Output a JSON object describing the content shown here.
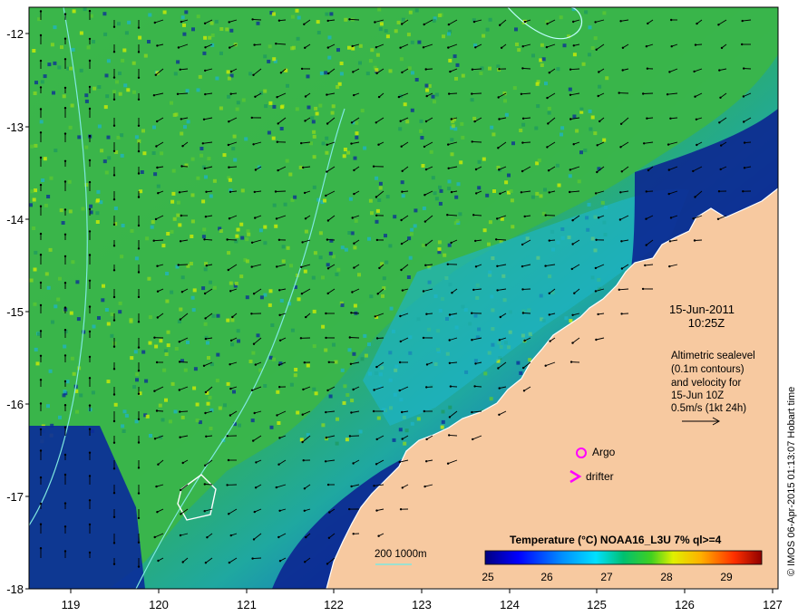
{
  "map": {
    "lat_ticks": [
      "-12",
      "-13",
      "-14",
      "-15",
      "-16",
      "-17",
      "-18"
    ],
    "lon_ticks": [
      "119",
      "120",
      "121",
      "122",
      "123",
      "124",
      "125",
      "126",
      "127"
    ],
    "lat_range": [
      -18,
      -11.8
    ],
    "lon_range": [
      118.55,
      127
    ]
  },
  "annotations": {
    "date": "15-Jun-2011",
    "time": "10:25Z",
    "altimetry_lines": [
      "Altimetric sealevel",
      "(0.1m contours)",
      "and velocity for",
      "15-Jun 10Z",
      "0.5m/s (1kt 24h)"
    ],
    "argo_label": "Argo",
    "drifter_label": "drifter",
    "bathymetry_label": "200  1000m",
    "credit": "© IMOS 06-Apr-2015 01:13:07 Hobart time"
  },
  "colorbar": {
    "title": "Temperature (°C) NOAA16_L3U 7% ql>=4",
    "ticks": [
      "25",
      "26",
      "27",
      "28",
      "29"
    ],
    "range": [
      25,
      29.7
    ]
  },
  "colors": {
    "land": "#f7c9a0",
    "bathy_contour": "#7fe8e0",
    "argo_drifter": "#ff00ff",
    "warm_sst": "#2fb53a",
    "cool_sst": "#081880"
  }
}
